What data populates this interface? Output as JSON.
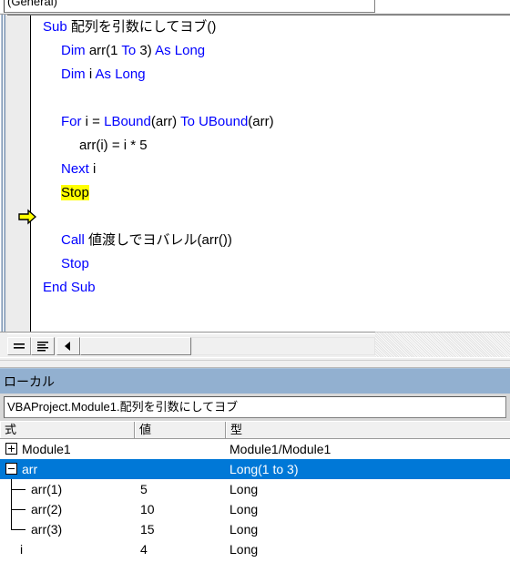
{
  "code_window": {
    "proc_combo": {
      "value": "(General)",
      "icon": "chevron-down-icon"
    },
    "indicator": {
      "icon": "execution-arrow-icon",
      "line_index": 8
    },
    "lines": [
      {
        "indent": 0,
        "tokens": [
          {
            "t": "Sub ",
            "c": "kw"
          },
          {
            "t": "配列を引数にしてヨブ()",
            "c": "pl"
          }
        ]
      },
      {
        "indent": 1,
        "tokens": [
          {
            "t": "Dim ",
            "c": "kw"
          },
          {
            "t": "arr(1 ",
            "c": "pl"
          },
          {
            "t": "To",
            "c": "kw"
          },
          {
            "t": " 3) ",
            "c": "pl"
          },
          {
            "t": "As Long",
            "c": "kw"
          }
        ]
      },
      {
        "indent": 1,
        "tokens": [
          {
            "t": "Dim ",
            "c": "kw"
          },
          {
            "t": "i ",
            "c": "pl"
          },
          {
            "t": "As Long",
            "c": "kw"
          }
        ]
      },
      {
        "indent": 0,
        "tokens": [
          {
            "t": "",
            "c": "pl"
          }
        ]
      },
      {
        "indent": 1,
        "tokens": [
          {
            "t": "For",
            "c": "kw"
          },
          {
            "t": " i = ",
            "c": "pl"
          },
          {
            "t": "LBound",
            "c": "kw"
          },
          {
            "t": "(arr) ",
            "c": "pl"
          },
          {
            "t": "To",
            "c": "kw"
          },
          {
            "t": " ",
            "c": "pl"
          },
          {
            "t": "UBound",
            "c": "kw"
          },
          {
            "t": "(arr)",
            "c": "pl"
          }
        ]
      },
      {
        "indent": 2,
        "tokens": [
          {
            "t": "arr(i) = i * 5",
            "c": "pl"
          }
        ]
      },
      {
        "indent": 1,
        "tokens": [
          {
            "t": "Next",
            "c": "kw"
          },
          {
            "t": " i",
            "c": "pl"
          }
        ]
      },
      {
        "indent": 1,
        "tokens": [
          {
            "t": "Stop",
            "c": "hl"
          }
        ]
      },
      {
        "indent": 0,
        "tokens": [
          {
            "t": "",
            "c": "pl"
          }
        ]
      },
      {
        "indent": 1,
        "tokens": [
          {
            "t": "Call",
            "c": "kw"
          },
          {
            "t": " 値渡しでヨバレル(arr())",
            "c": "pl"
          }
        ]
      },
      {
        "indent": 1,
        "tokens": [
          {
            "t": "Stop",
            "c": "kw"
          }
        ]
      },
      {
        "indent": 0,
        "tokens": [
          {
            "t": "End Sub",
            "c": "kw"
          }
        ]
      }
    ],
    "toolbar": {
      "procedure_view_icon": "procedure-view-icon",
      "full_module_view_icon": "full-module-view-icon",
      "scroll_left_icon": "scroll-left-arrow-icon"
    }
  },
  "locals_window": {
    "title": "ローカル",
    "context": "VBAProject.Module1.配列を引数にしてヨブ",
    "columns": [
      "式",
      "値",
      "型"
    ],
    "rows": [
      {
        "expr": "Module1",
        "value": "",
        "type": "Module1/Module1",
        "node": "plus",
        "level": 0,
        "selected": false
      },
      {
        "expr": "arr",
        "value": "",
        "type": "Long(1 to 3)",
        "node": "minus",
        "level": 0,
        "selected": true
      },
      {
        "expr": "arr(1)",
        "value": "5",
        "type": "Long",
        "node": "branch",
        "level": 1,
        "selected": false
      },
      {
        "expr": "arr(2)",
        "value": "10",
        "type": "Long",
        "node": "branch",
        "level": 1,
        "selected": false
      },
      {
        "expr": "arr(3)",
        "value": "15",
        "type": "Long",
        "node": "branch-last",
        "level": 1,
        "selected": false
      },
      {
        "expr": "i",
        "value": "4",
        "type": "Long",
        "node": "none",
        "level": 0,
        "selected": false
      }
    ]
  },
  "colors": {
    "keyword": "#0000ff",
    "highlight_bg": "#ffff00",
    "selection_bg": "#0078d7",
    "titlebar_bg": "#92b0d0",
    "margin_bg": "#ececec"
  }
}
